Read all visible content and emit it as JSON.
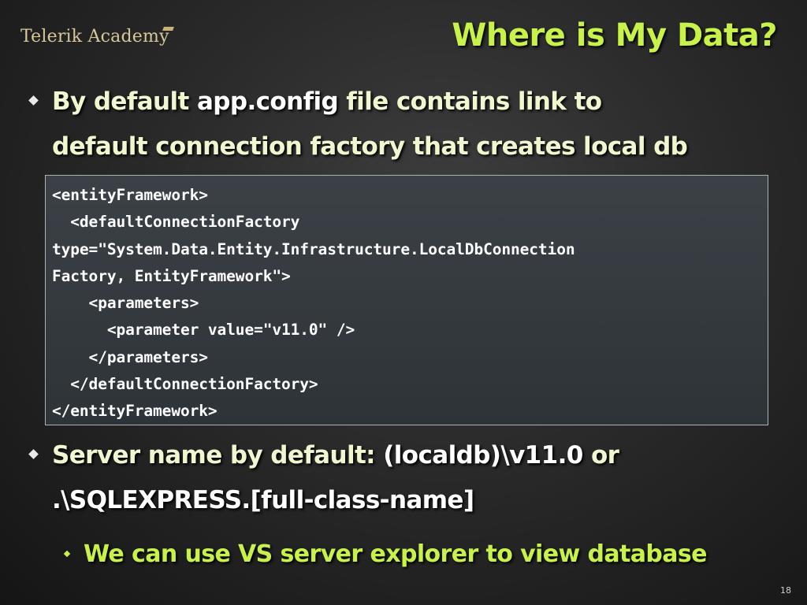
{
  "logo": {
    "text": "Telerik Academy"
  },
  "slide": {
    "title": "Where is My Data?",
    "bullets": [
      {
        "line1_a": "By default ",
        "line1_b": "app.config",
        "line1_c": " file contains link to",
        "line2": "default connection factory that creates local db"
      },
      {
        "line1_a": "Server name by default: ",
        "line1_b": "(localdb)\\v11.0",
        "line1_c": " or",
        "line2": ".\\SQLEXPRESS.[full-class-name]"
      }
    ],
    "sub_bullet": "We can use VS server explorer to view database",
    "code_lines": [
      "<entityFramework>",
      "  <defaultConnectionFactory",
      "type=\"System.Data.Entity.Infrastructure.LocalDbConnection",
      "Factory, EntityFramework\">",
      "    <parameters>",
      "      <parameter value=\"v11.0\" />",
      "    </parameters>",
      "  </defaultConnectionFactory>",
      "</entityFramework>"
    ],
    "page_number": "18"
  },
  "colors": {
    "title": "#c8f24a",
    "text": "#f0f7d0",
    "highlight": "#ffffff",
    "code_bg": "#353b40"
  }
}
